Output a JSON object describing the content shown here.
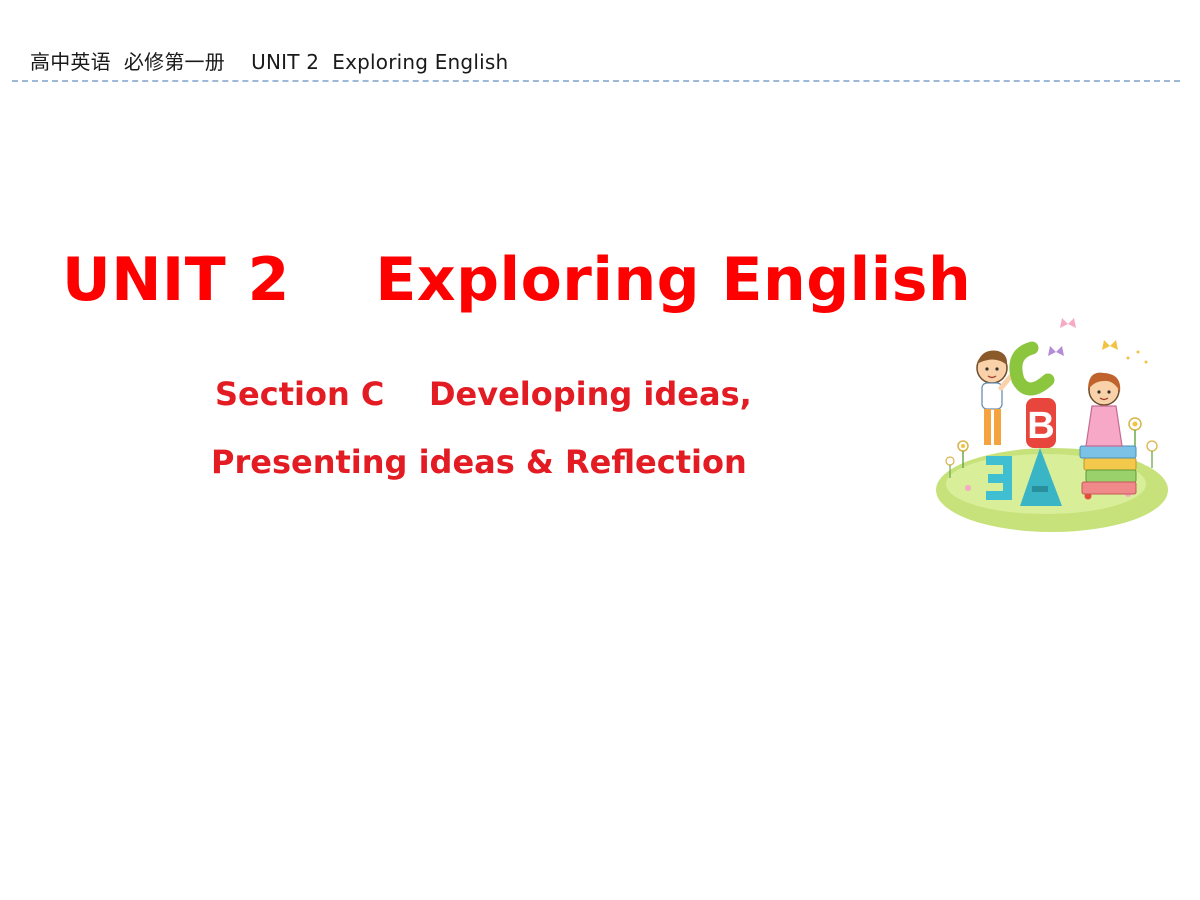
{
  "header": {
    "text": "高中英语  必修第一册    UNIT 2  Exploring English"
  },
  "title": {
    "text": "UNIT 2    Exploring English"
  },
  "subtitle": {
    "line1": "Section C    Developing ideas,",
    "line2": "Presenting ideas & Reflection"
  },
  "illustration": {
    "icon": "kids-with-abc-letters-illustration",
    "letters": [
      "C",
      "B",
      "A",
      "Ǝ"
    ]
  },
  "colors": {
    "title": "#ff0000",
    "subtitle": "#e31b23",
    "header_text": "#1a1a1a",
    "header_rule": "#9db8d8"
  }
}
